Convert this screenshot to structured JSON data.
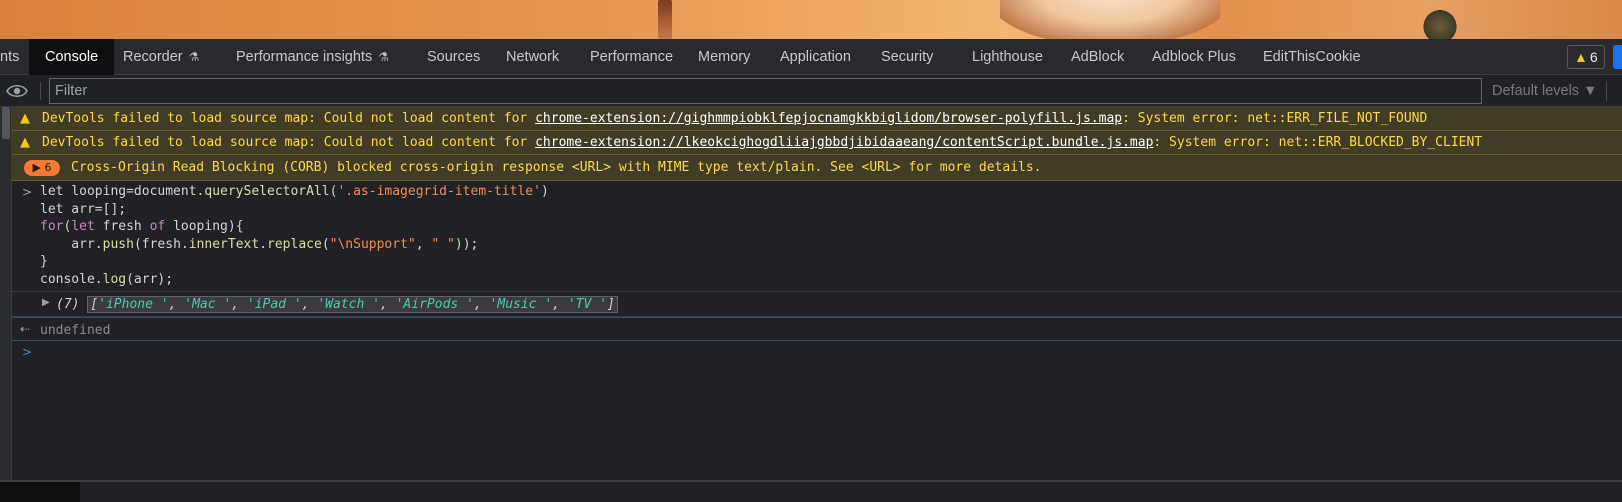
{
  "tabs": [
    {
      "label": "nts"
    },
    {
      "label": "Console"
    },
    {
      "label": "Recorder"
    },
    {
      "label": "Performance insights"
    },
    {
      "label": "Sources"
    },
    {
      "label": "Network"
    },
    {
      "label": "Performance"
    },
    {
      "label": "Memory"
    },
    {
      "label": "Application"
    },
    {
      "label": "Security"
    },
    {
      "label": "Lighthouse"
    },
    {
      "label": "AdBlock"
    },
    {
      "label": "Adblock Plus"
    },
    {
      "label": "EditThisCookie"
    }
  ],
  "issues_badge": {
    "count": "6"
  },
  "filter": {
    "placeholder": "Filter",
    "levels_label": "Default levels ▼"
  },
  "messages": {
    "warn1": {
      "prefix": "DevTools failed to load source map: Could not load content for ",
      "link": "chrome-extension://gighmmpiobklfepjocnamgkkbiglidom/browser-polyfill.js.map",
      "suffix": ": System error: net::ERR_FILE_NOT_FOUND"
    },
    "warn2": {
      "prefix": "DevTools failed to load source map: Could not load content for ",
      "link": "chrome-extension://lkeokcighogdliiajgbbdjibidaaeang/contentScript.bundle.js.map",
      "suffix": ": System error: net::ERR_BLOCKED_BY_CLIENT"
    },
    "corb": {
      "count": "▶ 6",
      "text": "Cross-Origin Read Blocking (CORB) blocked cross-origin response <URL> with MIME type text/plain. See <URL> for more details."
    }
  },
  "code": {
    "l1_kw": "let",
    "l1_a": " looping=document.",
    "l1_fn": "querySelectorAll",
    "l1_b": "(",
    "l1_str": "'.as-imagegrid-item-title'",
    "l1_c": ")",
    "l2_kw": "let",
    "l2_a": " arr=[];",
    "l3_kw": "for",
    "l3_a": "(",
    "l3_kw2": "let",
    "l3_b": " fresh ",
    "l3_kw3": "of",
    "l3_c": " looping){",
    "l4_a": "    arr.",
    "l4_fn": "push",
    "l4_b": "(fresh.",
    "l4_fn2": "innerText",
    "l4_c": ".",
    "l4_fn3": "replace",
    "l4_d": "(",
    "l4_str1": "\"\\nSupport\"",
    "l4_e": ", ",
    "l4_str2": "\" \"",
    "l4_f": "));",
    "l5": "}",
    "l6_a": "console.",
    "l6_fn": "log",
    "l6_b": "(arr);"
  },
  "result": {
    "prefix": "(7) ",
    "open": "[",
    "items": [
      "'iPhone '",
      "'Mac '",
      "'iPad '",
      "'Watch '",
      "'AirPods '",
      "'Music '",
      "'TV '"
    ],
    "close": "]"
  },
  "return_value": "undefined"
}
